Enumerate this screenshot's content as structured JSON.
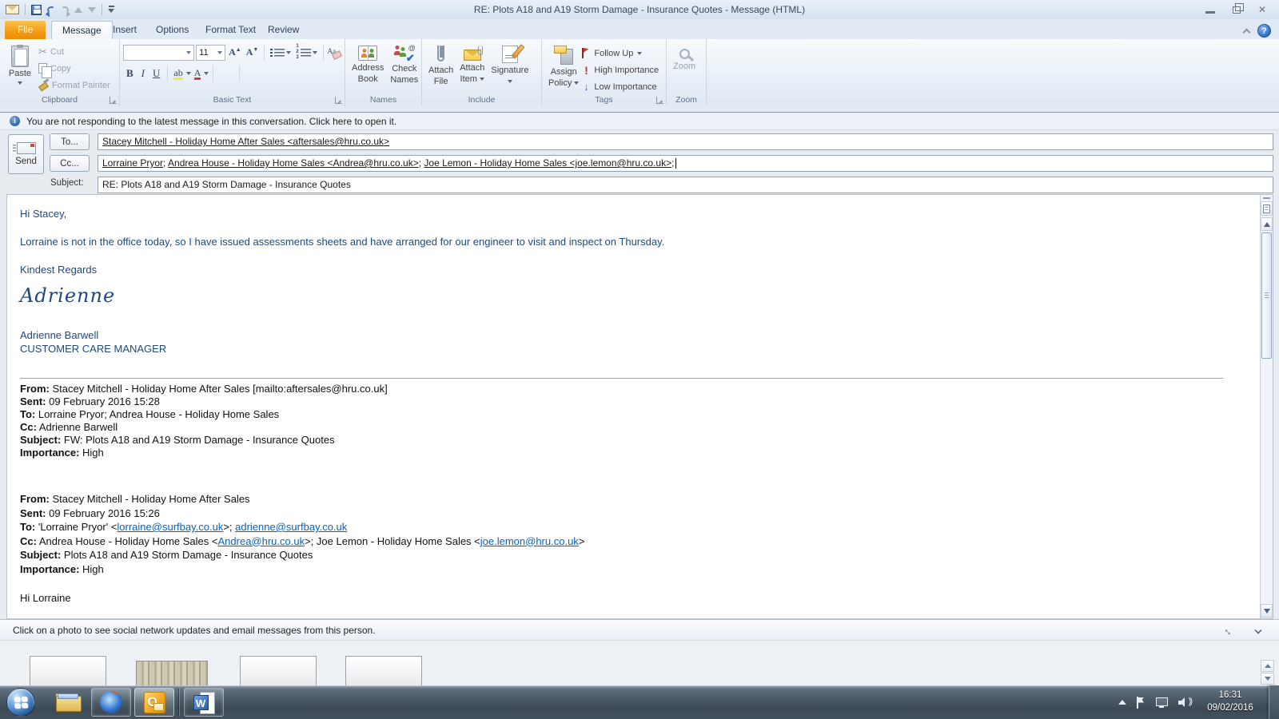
{
  "titlebar": {
    "title": "RE: Plots A18 and A19 Storm Damage - Insurance Quotes -  Message (HTML)"
  },
  "tabs": {
    "file": "File",
    "message": "Message",
    "insert": "Insert",
    "options": "Options",
    "format_text": "Format Text",
    "review": "Review"
  },
  "ribbon": {
    "clipboard": {
      "label": "Clipboard",
      "paste": "Paste",
      "cut": "Cut",
      "copy": "Copy",
      "format_painter": "Format Painter"
    },
    "basic_text": {
      "label": "Basic Text",
      "font_size": "11",
      "bold": "B",
      "italic": "I",
      "underline": "U",
      "grow_font": "A",
      "shrink_font": "A",
      "highlight": "ab",
      "font_color": "A"
    },
    "names": {
      "label": "Names",
      "address_book_line1": "Address",
      "address_book_line2": "Book",
      "check_names_line1": "Check",
      "check_names_line2": "Names"
    },
    "include": {
      "label": "Include",
      "attach_file_line1": "Attach",
      "attach_file_line2": "File",
      "attach_item_line1": "Attach",
      "attach_item_line2": "Item",
      "signature": "Signature"
    },
    "tags": {
      "label": "Tags",
      "assign_policy_line1": "Assign",
      "assign_policy_line2": "Policy",
      "follow_up": "Follow Up",
      "high_importance": "High Importance",
      "low_importance": "Low Importance"
    },
    "zoom_group": {
      "label": "Zoom",
      "zoom": "Zoom"
    }
  },
  "infobar": {
    "text": "You are not responding to the latest message in this conversation. Click here to open it."
  },
  "compose": {
    "send": "Send",
    "to_button": "To...",
    "cc_button": "Cc...",
    "subject_label": "Subject:",
    "to_value": "Stacey Mitchell - Holiday Home After Sales <aftersales@hru.co.uk>",
    "cc_recipient1": "Lorraine Pryor",
    "cc_recipient2": "Andrea House - Holiday Home Sales <Andrea@hru.co.uk>",
    "cc_recipient3": "Joe Lemon - Holiday Home Sales <joe.lemon@hru.co.uk>",
    "separator": "; ",
    "trailing_semicolon": ";",
    "subject_value": "RE: Plots A18 and A19 Storm Damage - Insurance Quotes"
  },
  "message": {
    "greeting": "Hi Stacey,",
    "body_line": "Lorraine is not in the office today, so I have issued assessments sheets and have arranged for our engineer to visit and inspect on Thursday.",
    "closing": "Kindest Regards",
    "signature_script": "Adrienne",
    "signature_name": "Adrienne Barwell",
    "signature_title": "CUSTOMER CARE MANAGER"
  },
  "quoted1": {
    "from_label": "From:",
    "from_value": " Stacey Mitchell - Holiday Home After Sales [mailto:aftersales@hru.co.uk]",
    "sent_label": "Sent:",
    "sent_value": " 09 February 2016 15:28",
    "to_label": "To:",
    "to_value": " Lorraine Pryor; Andrea House - Holiday Home Sales",
    "cc_label": "Cc:",
    "cc_value": " Adrienne Barwell",
    "subject_label": "Subject:",
    "subject_value": " FW: Plots A18 and A19 Storm Damage - Insurance Quotes",
    "importance_label": "Importance:",
    "importance_value": " High"
  },
  "quoted2": {
    "from_label": "From:",
    "from_value": " Stacey Mitchell - Holiday Home After Sales",
    "sent_label": "Sent:",
    "sent_value": " 09 February 2016 15:26",
    "to_label": "To:",
    "to_pre": " 'Lorraine Pryor' <",
    "to_link1": "lorraine@surfbay.co.uk",
    "to_mid": ">; ",
    "to_link2": "adrienne@surfbay.co.uk",
    "cc_label": "Cc:",
    "cc_pre": " Andrea House - Holiday Home Sales <",
    "cc_link1": "Andrea@hru.co.uk",
    "cc_mid": ">; Joe Lemon - Holiday Home Sales <",
    "cc_link2": "joe.lemon@hru.co.uk",
    "cc_post": ">",
    "subject_label": "Subject:",
    "subject_value": " Plots A18 and A19 Storm Damage - Insurance Quotes",
    "importance_label": "Importance:",
    "importance_value": " High",
    "greeting": "Hi Lorraine"
  },
  "people_pane": {
    "hint": "Click on a photo to see social network updates and email messages from this person."
  },
  "taskbar": {
    "time": "16:31",
    "date": "09/02/2016"
  },
  "icons": {
    "cut": "✂",
    "check_mark": "✔",
    "at_sign": "@",
    "high_importance": "!",
    "low_importance": "↓",
    "help": "?",
    "close": "✕",
    "info": "i",
    "outlook_logo": "O",
    "word_logo": "W",
    "speaker_waves": "))"
  },
  "colors": {
    "message_text": "#1F497D",
    "hyperlink": "#0563C1",
    "file_tab": "#F29B12",
    "ribbon_bg": "#EDF2F9",
    "taskbar_bg": "#46545F"
  }
}
